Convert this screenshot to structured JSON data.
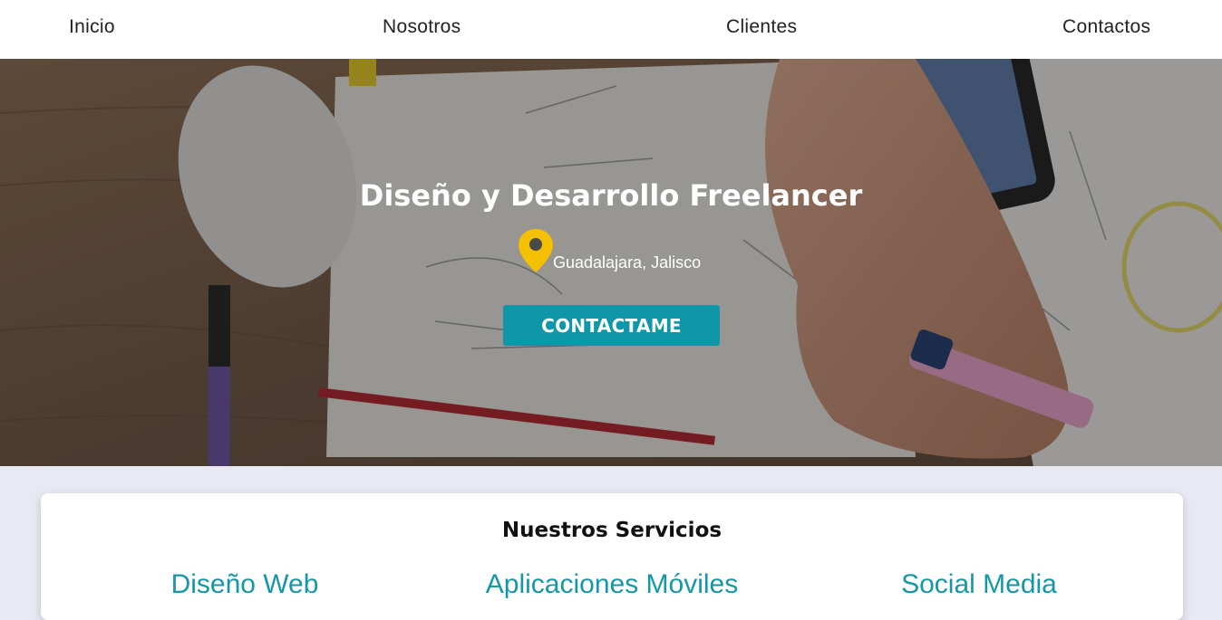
{
  "nav": {
    "items": [
      {
        "label": "Inicio"
      },
      {
        "label": "Nosotros"
      },
      {
        "label": "Clientes"
      },
      {
        "label": "Contactos"
      }
    ]
  },
  "hero": {
    "title": "Diseño y Desarrollo Freelancer",
    "location_icon": "map-pin-icon",
    "location": "Guadalajara, Jalisco",
    "cta_label": "CONTACTAME",
    "background": "desk-workspace-photo"
  },
  "services": {
    "title": "Nuestros Servicios",
    "items": [
      {
        "label": "Diseño Web"
      },
      {
        "label": "Aplicaciones Móviles"
      },
      {
        "label": "Social Media"
      }
    ]
  },
  "colors": {
    "accent": "#0e97a8",
    "pin": "#f5c000",
    "nav_bg": "#ffffff",
    "page_bg": "#e8e9f3"
  }
}
